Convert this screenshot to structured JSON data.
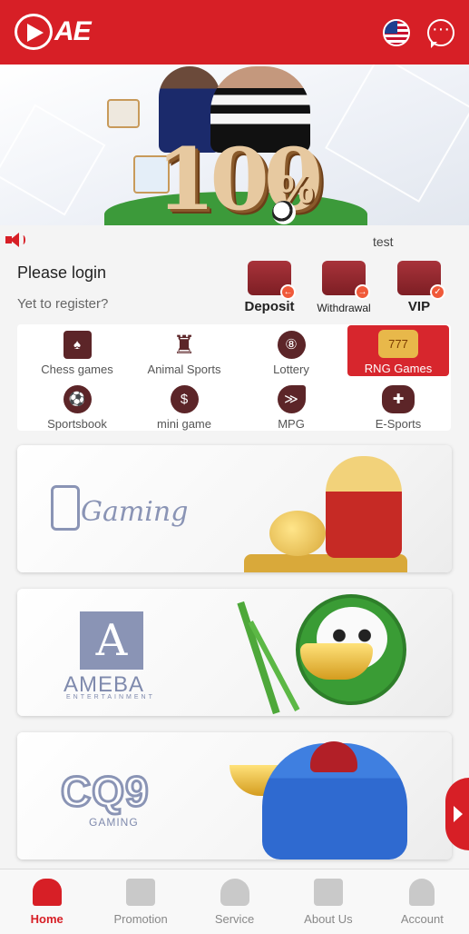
{
  "header": {
    "logo_text": "AE",
    "language_icon": "us-flag-icon",
    "message_icon": "chat-bubble-icon"
  },
  "banner": {
    "headline": "100",
    "headline_suffix": "%"
  },
  "announcement": {
    "icon": "megaphone-icon",
    "text": "test"
  },
  "user": {
    "login_label": "Please login",
    "register_label": "Yet to register?",
    "actions": [
      {
        "label": "Deposit",
        "icon": "wallet-icon"
      },
      {
        "label": "Withdrawal",
        "icon": "withdraw-icon"
      },
      {
        "label": "VIP",
        "icon": "vip-crown-icon"
      }
    ]
  },
  "categories": [
    {
      "label": "Chess games",
      "icon": "spade-card-icon"
    },
    {
      "label": "Animal Sports",
      "icon": "rooster-icon"
    },
    {
      "label": "Lottery",
      "icon": "lottery-ball-icon"
    },
    {
      "label": "RNG Games",
      "icon": "slot-machine-icon",
      "active": true
    },
    {
      "label": "Sportsbook",
      "icon": "soccer-ball-icon"
    },
    {
      "label": "mini game",
      "icon": "coin-icon"
    },
    {
      "label": "MPG",
      "icon": "fish-icon"
    },
    {
      "label": "E-Sports",
      "icon": "gamepad-icon"
    }
  ],
  "providers": [
    {
      "logo_text": "Gaming"
    },
    {
      "logo_text": "AMEBA",
      "logo_subtext": "ENTERTAINMENT"
    },
    {
      "logo_text": "CQ9",
      "logo_subtext": "GAMING"
    }
  ],
  "bottom_nav": [
    {
      "label": "Home",
      "icon": "home-icon",
      "active": true
    },
    {
      "label": "Promotion",
      "icon": "gift-icon"
    },
    {
      "label": "Service",
      "icon": "headset-icon"
    },
    {
      "label": "About Us",
      "icon": "star-badge-icon"
    },
    {
      "label": "Account",
      "icon": "user-icon"
    }
  ],
  "colors": {
    "primary": "#d71f26",
    "icon_dark": "#5c2528"
  }
}
